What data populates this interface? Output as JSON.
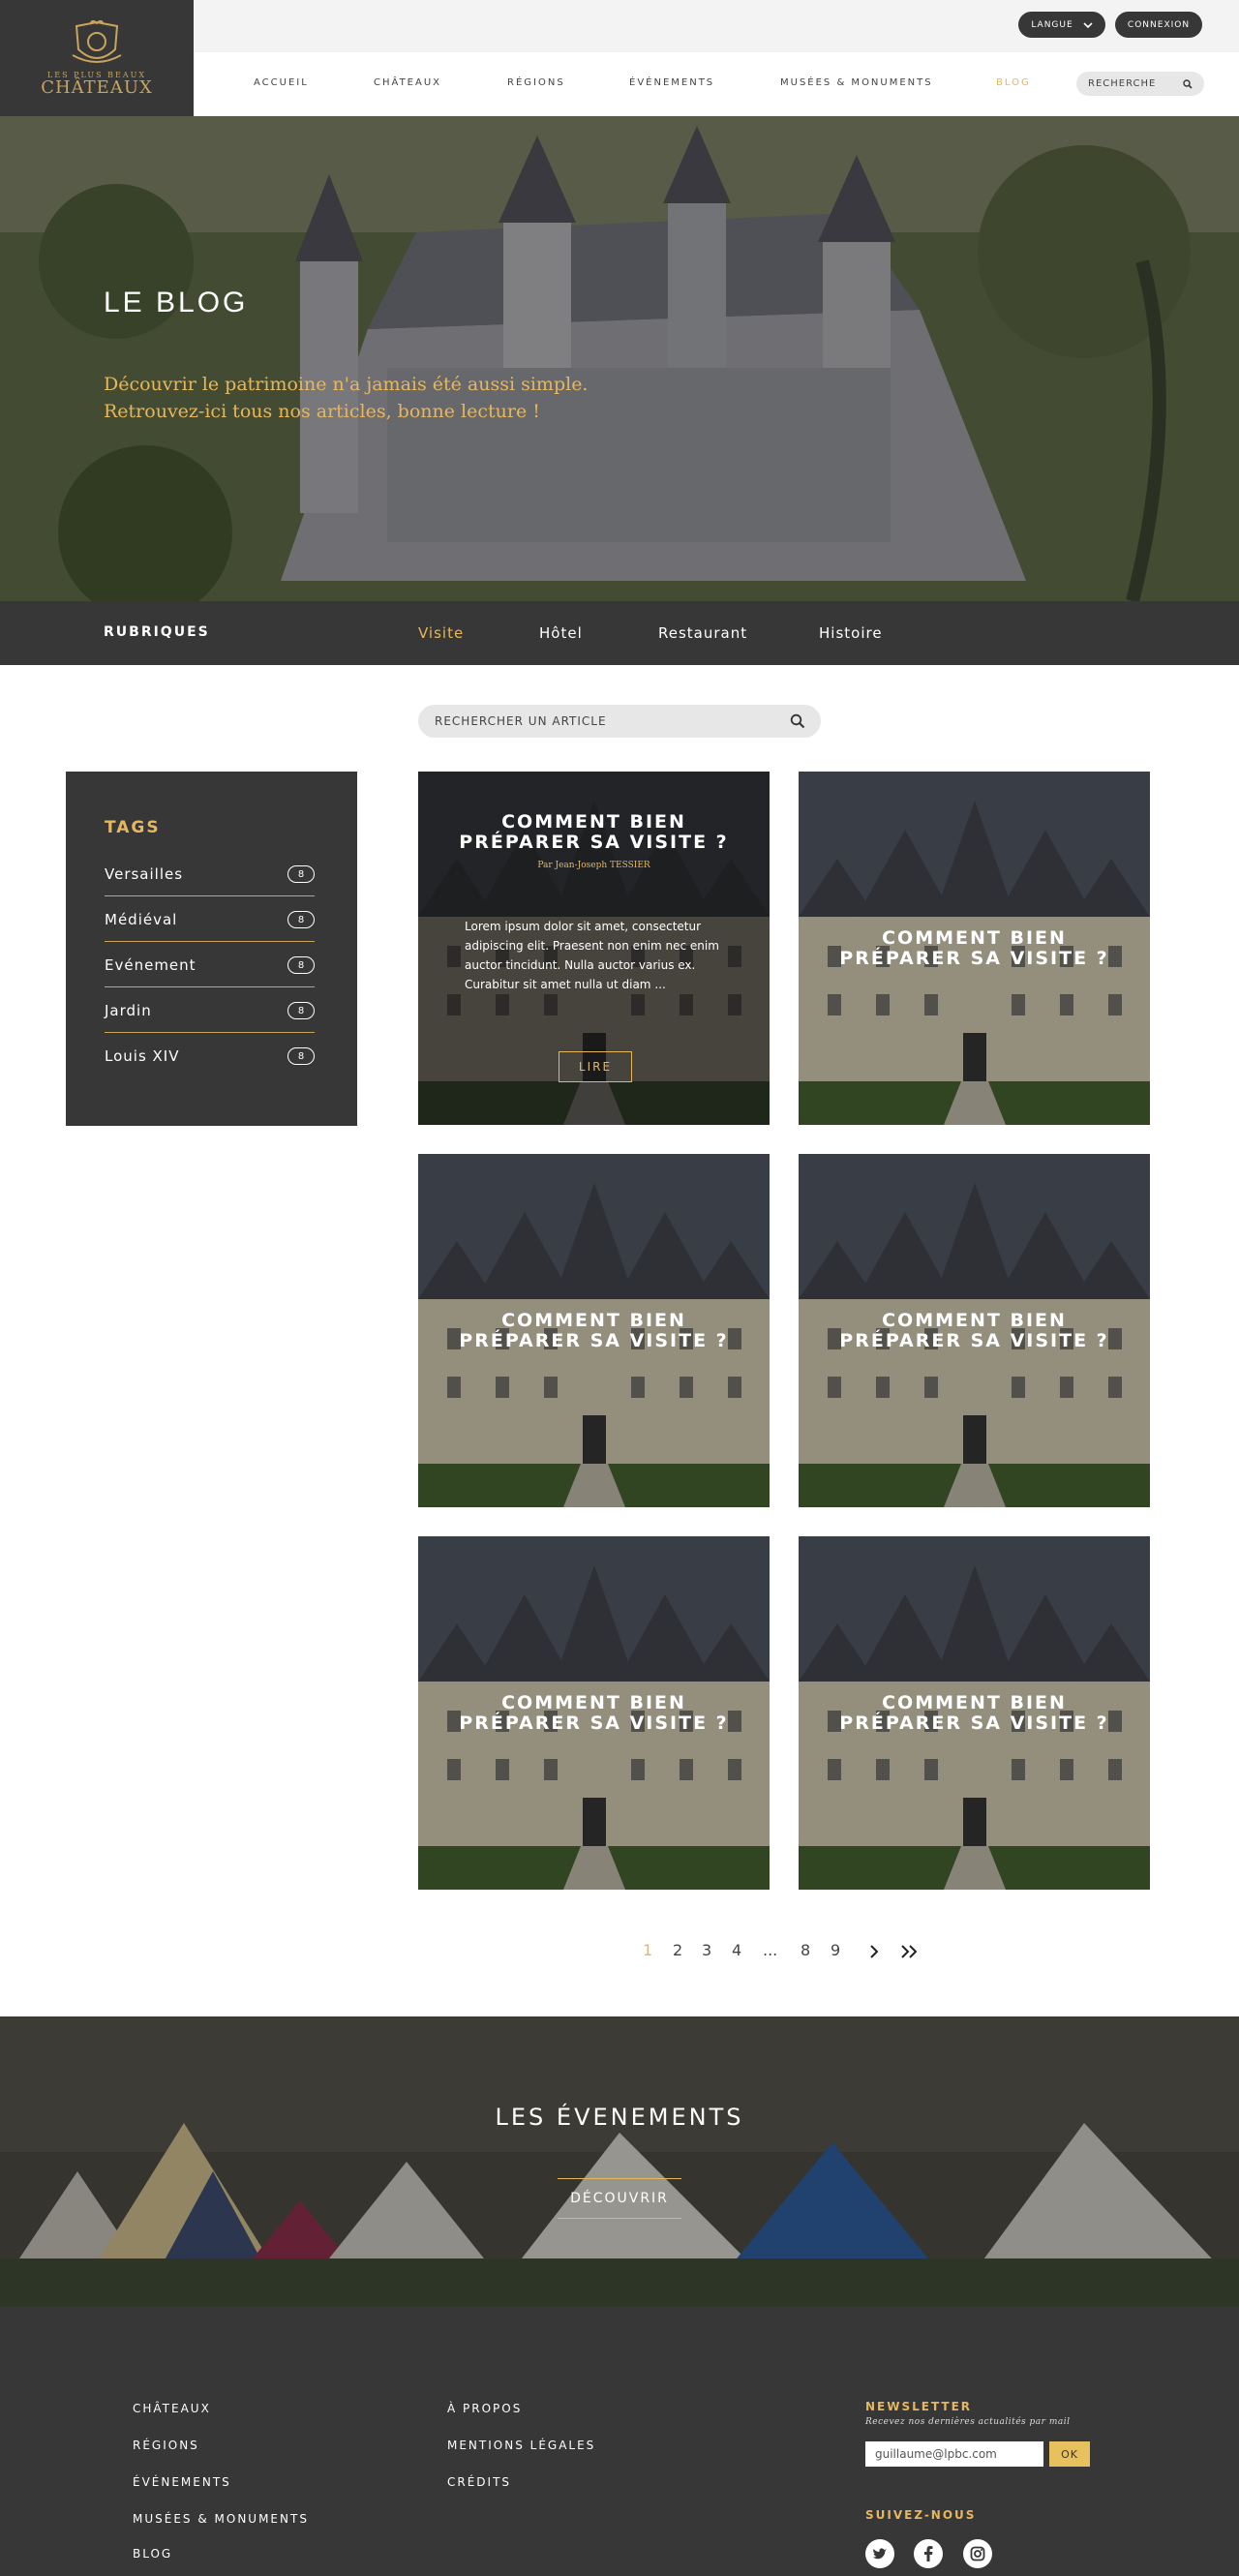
{
  "brand": {
    "top_line": "LES PLUS BEAUX",
    "name": "CHÂTEAUX"
  },
  "topbar": {
    "language_label": "LANGUE",
    "login_label": "CONNEXION"
  },
  "nav": {
    "items": [
      {
        "label": "ACCUEIL",
        "active": false
      },
      {
        "label": "CHÂTEAUX",
        "active": false
      },
      {
        "label": "RÉGIONS",
        "active": false
      },
      {
        "label": "ÉVÉNEMENTS",
        "active": false
      },
      {
        "label": "MUSÉES & MONUMENTS",
        "active": false
      },
      {
        "label": "BLOG",
        "active": true
      }
    ],
    "search_label": "RECHERCHE"
  },
  "hero": {
    "title": "LE BLOG",
    "subtitle_line1": "Découvrir le patrimoine n'a jamais été aussi simple.",
    "subtitle_line2": "Retrouvez-ici tous nos articles, bonne lecture !"
  },
  "rubriques": {
    "title": "RUBRIQUES",
    "items": [
      {
        "label": "Visite",
        "active": true
      },
      {
        "label": "Hôtel",
        "active": false
      },
      {
        "label": "Restaurant",
        "active": false
      },
      {
        "label": "Histoire",
        "active": false
      }
    ]
  },
  "article_search": {
    "placeholder": "RECHERCHER UN ARTICLE"
  },
  "tags": {
    "title": "TAGS",
    "items": [
      {
        "label": "Versailles",
        "count": "8"
      },
      {
        "label": "Médiéval",
        "count": "8"
      },
      {
        "label": "Evénement",
        "count": "8"
      },
      {
        "label": "Jardin",
        "count": "8"
      },
      {
        "label": "Louis XIV",
        "count": "8"
      }
    ]
  },
  "articles": [
    {
      "title_line1": "COMMENT BIEN",
      "title_line2": "PRÉPARER SA VISITE ?",
      "author": "Par Jean-Joseph TESSIER",
      "excerpt": "Lorem ipsum dolor sit amet, consectetur adipiscing elit. Praesent non enim nec enim auctor tincidunt. Nulla auctor varius ex. Curabitur sit amet nulla ut diam ...",
      "button": "LIRE",
      "featured": true
    },
    {
      "title_line1": "COMMENT BIEN",
      "title_line2": "PRÉPARER SA VISITE ?",
      "featured": false
    },
    {
      "title_line1": "COMMENT BIEN",
      "title_line2": "PRÉPARER SA VISITE ?",
      "featured": false
    },
    {
      "title_line1": "COMMENT BIEN",
      "title_line2": "PRÉPARER SA VISITE ?",
      "featured": false
    },
    {
      "title_line1": "COMMENT BIEN",
      "title_line2": "PRÉPARER SA VISITE ?",
      "featured": false
    },
    {
      "title_line1": "COMMENT BIEN",
      "title_line2": "PRÉPARER SA VISITE ?",
      "featured": false
    }
  ],
  "pagination": {
    "pages": [
      "1",
      "2",
      "3",
      "4",
      "...",
      "8",
      "9"
    ],
    "current": "1",
    "next_icon": "chevron-right-icon",
    "last_icon": "double-chevron-right-icon"
  },
  "events": {
    "title": "LES ÉVENEMENTS",
    "button": "DÉCOUVRIR"
  },
  "footer": {
    "col1": [
      "CHÂTEAUX",
      "RÉGIONS",
      "ÉVÉNEMENTS",
      "MUSÉES & MONUMENTS",
      "BLOG"
    ],
    "col2": [
      "À PROPOS",
      "MENTIONS LÉGALES",
      "CRÉDITS"
    ],
    "newsletter_title": "NEWSLETTER",
    "newsletter_note": "Recevez nos dernières actualités par mail",
    "email_value": "guillaume@lpbc.com",
    "ok_label": "OK",
    "follow_title": "SUIVEZ-NOUS",
    "social_icons": [
      "twitter-icon",
      "facebook-icon",
      "instagram-icon"
    ]
  },
  "colors": {
    "gold": "#e6b75d",
    "dark": "#373737",
    "light": "#f3f3f3"
  }
}
